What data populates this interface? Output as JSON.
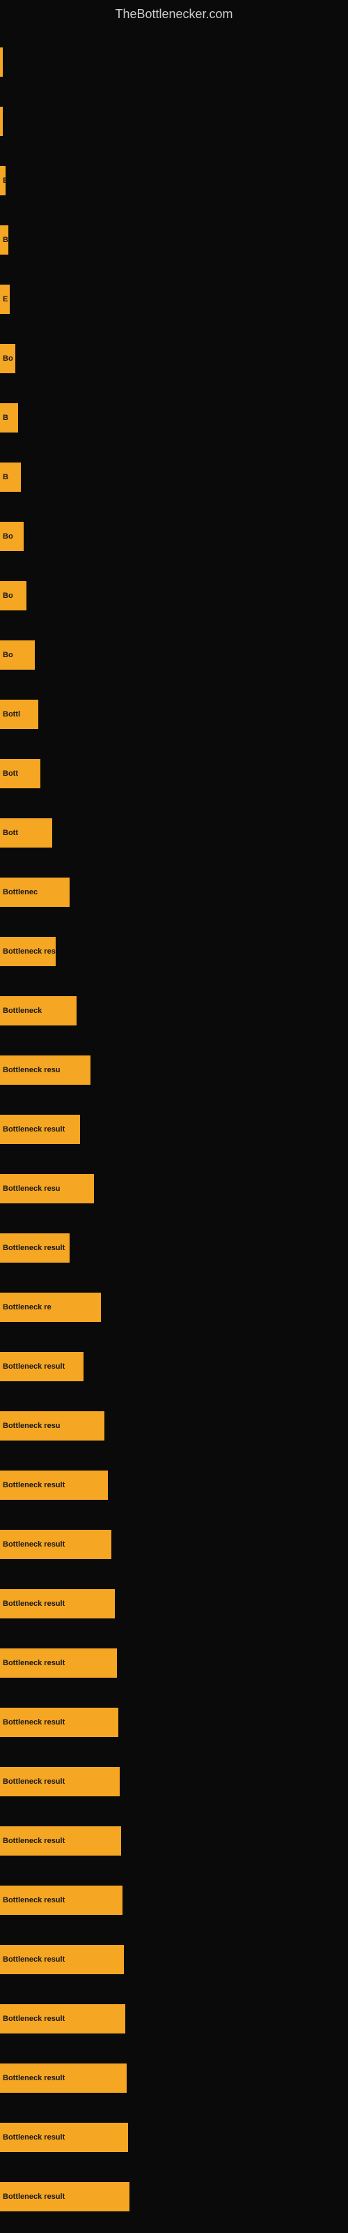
{
  "site": {
    "title": "TheBottlenecker.com"
  },
  "bars": [
    {
      "id": 1,
      "label": ""
    },
    {
      "id": 2,
      "label": ""
    },
    {
      "id": 3,
      "label": "E"
    },
    {
      "id": 4,
      "label": "B"
    },
    {
      "id": 5,
      "label": "E"
    },
    {
      "id": 6,
      "label": "Bo"
    },
    {
      "id": 7,
      "label": "B"
    },
    {
      "id": 8,
      "label": "B"
    },
    {
      "id": 9,
      "label": "Bo"
    },
    {
      "id": 10,
      "label": "Bo"
    },
    {
      "id": 11,
      "label": "Bo"
    },
    {
      "id": 12,
      "label": "Bottl"
    },
    {
      "id": 13,
      "label": "Bott"
    },
    {
      "id": 14,
      "label": "Bott"
    },
    {
      "id": 15,
      "label": "Bottlenec"
    },
    {
      "id": 16,
      "label": "Bottleneck res"
    },
    {
      "id": 17,
      "label": "Bottleneck"
    },
    {
      "id": 18,
      "label": "Bottleneck resu"
    },
    {
      "id": 19,
      "label": "Bottleneck result"
    },
    {
      "id": 20,
      "label": "Bottleneck resu"
    },
    {
      "id": 21,
      "label": "Bottleneck result"
    },
    {
      "id": 22,
      "label": "Bottleneck re"
    },
    {
      "id": 23,
      "label": "Bottleneck result"
    },
    {
      "id": 24,
      "label": "Bottleneck resu"
    },
    {
      "id": 25,
      "label": "Bottleneck result"
    },
    {
      "id": 26,
      "label": "Bottleneck result"
    },
    {
      "id": 27,
      "label": "Bottleneck result"
    },
    {
      "id": 28,
      "label": "Bottleneck result"
    },
    {
      "id": 29,
      "label": "Bottleneck result"
    },
    {
      "id": 30,
      "label": "Bottleneck result"
    },
    {
      "id": 31,
      "label": "Bottleneck result"
    },
    {
      "id": 32,
      "label": "Bottleneck result"
    },
    {
      "id": 33,
      "label": "Bottleneck result"
    },
    {
      "id": 34,
      "label": "Bottleneck result"
    },
    {
      "id": 35,
      "label": "Bottleneck result"
    },
    {
      "id": 36,
      "label": "Bottleneck result"
    },
    {
      "id": 37,
      "label": "Bottleneck result"
    }
  ]
}
